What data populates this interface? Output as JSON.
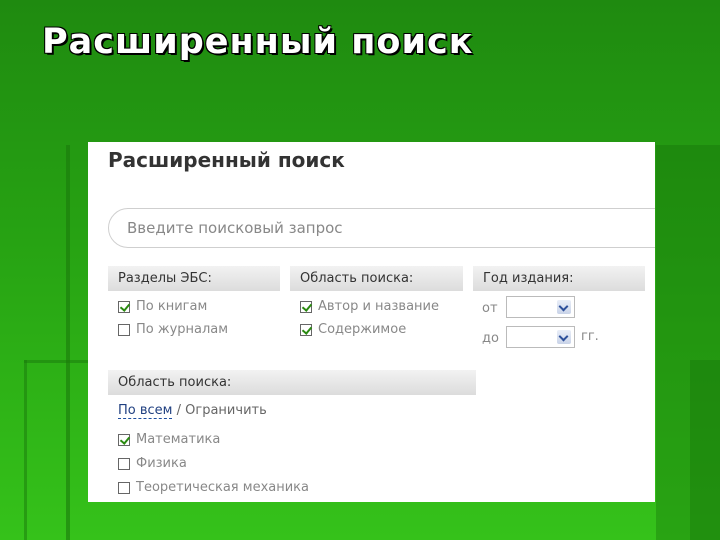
{
  "slide": {
    "title": "Расширенный поиск"
  },
  "panel": {
    "title": "Расширенный поиск",
    "search": {
      "placeholder": "Введите поисковый запрос",
      "value": ""
    },
    "sections": {
      "ebs": {
        "header": "Разделы ЭБС:",
        "items": [
          {
            "label": "По книгам",
            "checked": true
          },
          {
            "label": "По журналам",
            "checked": false
          }
        ]
      },
      "scope": {
        "header": "Область поиска:",
        "items": [
          {
            "label": "Автор и название",
            "checked": true
          },
          {
            "label": "Содержимое",
            "checked": true
          }
        ]
      },
      "year": {
        "header": "Год издания:",
        "from_label": "от",
        "to_label": "до",
        "suffix": "гг.",
        "from_value": "",
        "to_value": ""
      },
      "area": {
        "header": "Область поиска:",
        "all_link": "По всем",
        "separator": "/",
        "limit_link": "Ограничить",
        "items": [
          {
            "label": "Математика",
            "checked": true
          },
          {
            "label": "Физика",
            "checked": false
          },
          {
            "label": "Теоретическая механика",
            "checked": false
          }
        ]
      }
    }
  },
  "colors": {
    "background": "#27a313",
    "accent": "#2a8a10"
  }
}
